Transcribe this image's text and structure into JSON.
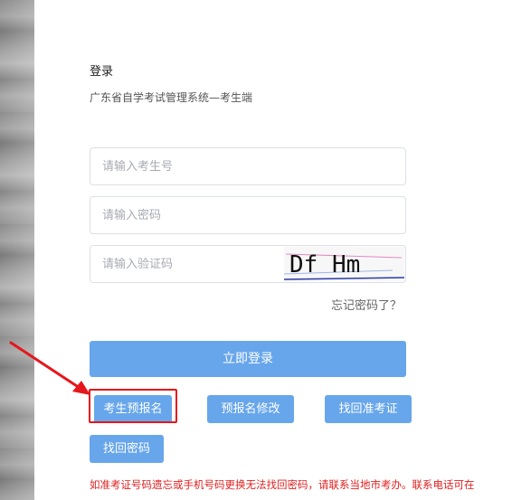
{
  "login": {
    "title": "登录",
    "subtitle": "广东省自学考试管理系统—考生端",
    "fields": {
      "exam_id_placeholder": "请输入考生号",
      "password_placeholder": "请输入密码",
      "captcha_placeholder": "请输入验证码"
    },
    "captcha_text": "Df Hm",
    "forgot_password_link": "忘记密码了？",
    "login_button": "立即登录",
    "buttons": {
      "pre_register": "考生预报名",
      "modify_pre_register": "预报名修改",
      "retrieve_exam_id": "找回准考证",
      "retrieve_password": "找回密码"
    },
    "notice": "如准考证号码遗忘或手机号码更换无法找回密码，请联系当地市考办。联系电话可在"
  },
  "colors": {
    "primary_button": "#67a6ea",
    "highlight_border": "#e5171c",
    "notice_text": "#e02020"
  },
  "annotations": {
    "arrow_icon": "red-arrow-icon",
    "highlight": "red-highlight-box"
  }
}
